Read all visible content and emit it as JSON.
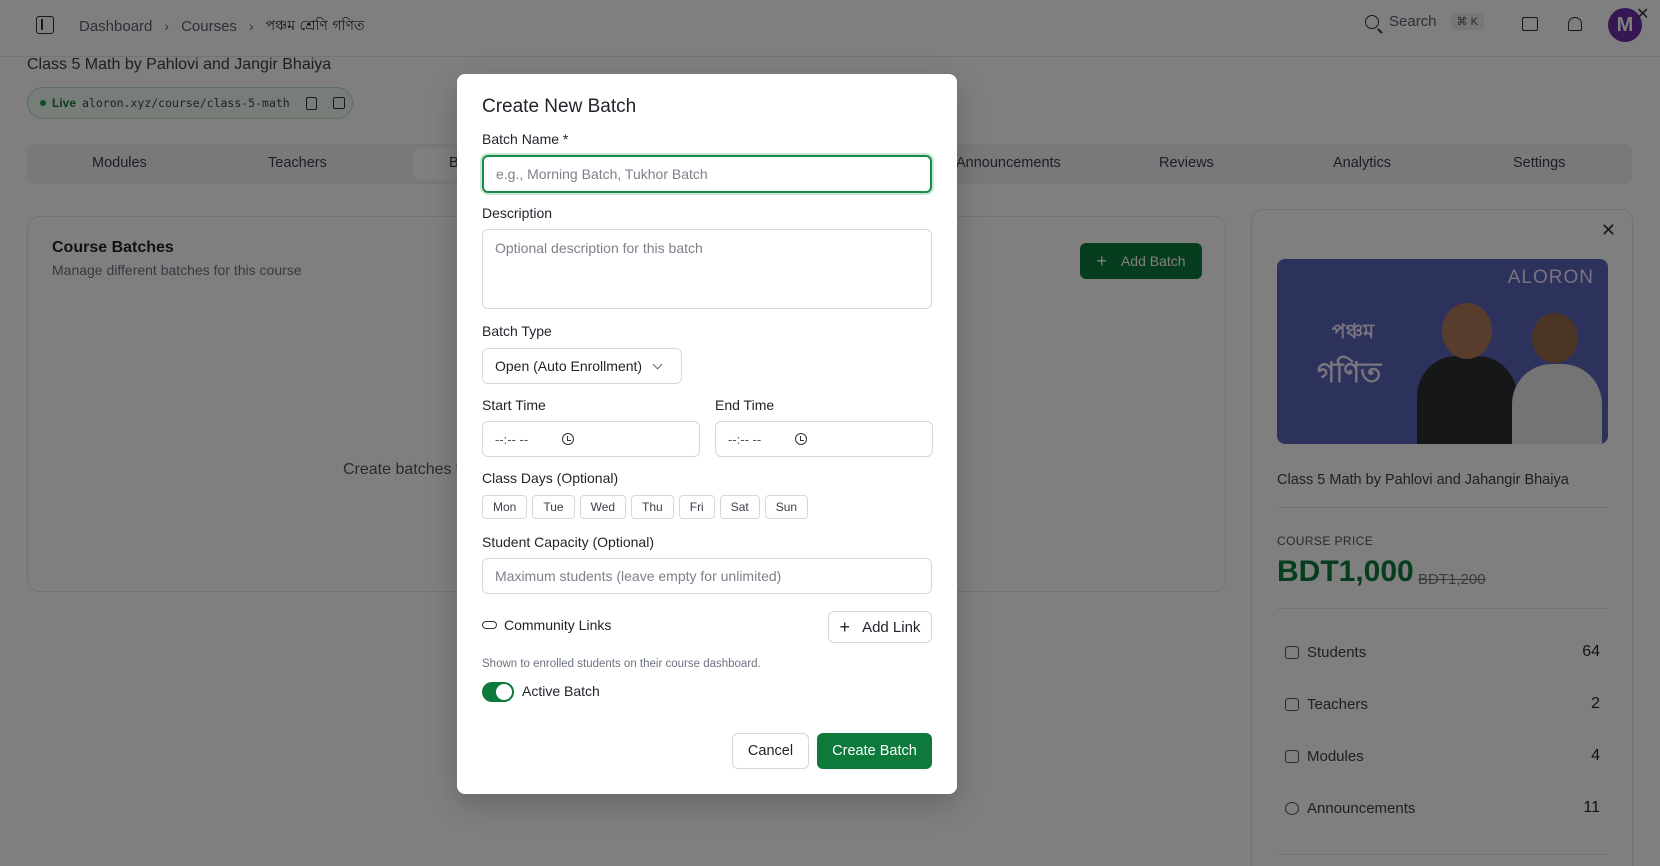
{
  "topbar": {
    "breadcrumb": [
      "Dashboard",
      "Courses",
      "পঞ্চম শ্রেণি গণিত"
    ],
    "search_label": "Search",
    "search_shortcut": "⌘ K",
    "avatar_letter": "M"
  },
  "course": {
    "title": "Class 5 Math by Pahlovi and Jangir Bhaiya",
    "live_label": "Live",
    "url": "aloron.xyz/course/class-5-math"
  },
  "tabs": [
    "Modules",
    "Teachers",
    "B",
    "Announcements",
    "Reviews",
    "Analytics",
    "Settings"
  ],
  "batches_card": {
    "title": "Course Batches",
    "subtitle": "Manage different batches for this course",
    "add_button": "Add Batch",
    "empty_text": "Create batches t"
  },
  "side_card": {
    "thumb_brand": "ALORON",
    "thumb_text_1": "পঞ্চম",
    "thumb_text_2": "গণিত",
    "course_title": "Class 5 Math by Pahlovi and Jahangir Bhaiya",
    "price_label": "COURSE PRICE",
    "price": "BDT1,000",
    "old_price": "BDT1,200",
    "stats": [
      {
        "icon": "users-icon",
        "label": "Students",
        "value": "64"
      },
      {
        "icon": "users-icon",
        "label": "Teachers",
        "value": "2"
      },
      {
        "icon": "book-icon",
        "label": "Modules",
        "value": "4"
      },
      {
        "icon": "broadcast-icon",
        "label": "Announcements",
        "value": "11"
      }
    ]
  },
  "modal": {
    "title": "Create New Batch",
    "batch_name_label": "Batch Name *",
    "batch_name_placeholder": "e.g., Morning Batch, Tukhor Batch",
    "description_label": "Description",
    "description_placeholder": "Optional description for this batch",
    "batch_type_label": "Batch Type",
    "batch_type_value": "Open (Auto Enrollment)",
    "start_time_label": "Start Time",
    "end_time_label": "End Time",
    "time_placeholder": "--:-- --",
    "class_days_label": "Class Days (Optional)",
    "days": [
      "Mon",
      "Tue",
      "Wed",
      "Thu",
      "Fri",
      "Sat",
      "Sun"
    ],
    "capacity_label": "Student Capacity (Optional)",
    "capacity_placeholder": "Maximum students (leave empty for unlimited)",
    "community_links_label": "Community Links",
    "add_link_label": "Add Link",
    "helper_text": "Shown to enrolled students on their course dashboard.",
    "active_label": "Active Batch",
    "active": true,
    "cancel_label": "Cancel",
    "create_label": "Create Batch"
  },
  "colors": {
    "accent": "#0d7a3c",
    "overlay": "rgba(0,0,0,0.5)"
  }
}
